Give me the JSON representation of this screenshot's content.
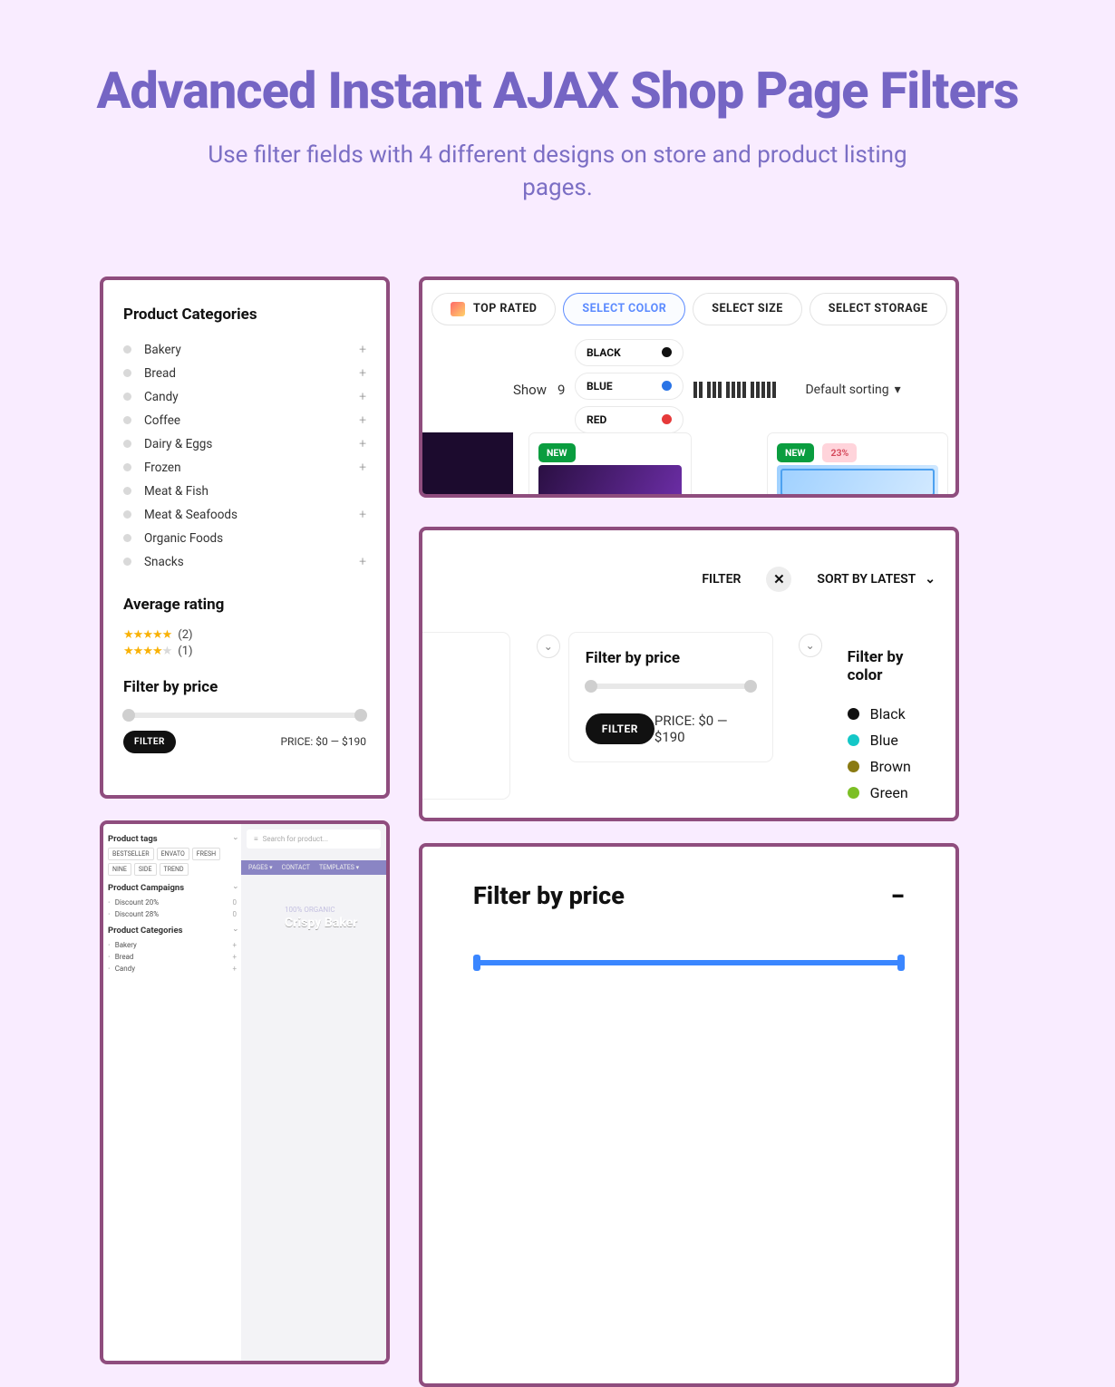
{
  "heading": "Advanced Instant AJAX Shop Page Filters",
  "subheading": "Use filter fields with 4 different designs on store and product listing pages.",
  "sidebar": {
    "title_categories": "Product Categories",
    "categories": [
      {
        "label": "Bakery",
        "expand": true
      },
      {
        "label": "Bread",
        "expand": true
      },
      {
        "label": "Candy",
        "expand": true
      },
      {
        "label": "Coffee",
        "expand": true
      },
      {
        "label": "Dairy & Eggs",
        "expand": true
      },
      {
        "label": "Frozen",
        "expand": true
      },
      {
        "label": "Meat & Fish",
        "expand": false
      },
      {
        "label": "Meat & Seafoods",
        "expand": true
      },
      {
        "label": "Organic Foods",
        "expand": false
      },
      {
        "label": "Snacks",
        "expand": true
      }
    ],
    "title_rating": "Average rating",
    "ratings": [
      {
        "stars": 5,
        "count": "(2)"
      },
      {
        "stars": 4,
        "count": "(1)"
      }
    ],
    "title_price": "Filter by price",
    "filter_btn": "FILTER",
    "price_text": "PRICE: $0 — $190"
  },
  "colorCard": {
    "pills": [
      "TOP RATED",
      "SELECT COLOR",
      "SELECT SIZE",
      "SELECT STORAGE"
    ],
    "colors": [
      {
        "name": "BLACK",
        "hex": "#111"
      },
      {
        "name": "BLUE",
        "hex": "#2a74e6"
      },
      {
        "name": "RED",
        "hex": "#e63a3a"
      }
    ],
    "show_label": "Show",
    "show_value": "9",
    "sort": "Default sorting",
    "badge_new": "NEW",
    "badge_disc": "23%"
  },
  "filterCard": {
    "filter_label": "FILTER",
    "sort_label": "SORT BY LATEST",
    "price_title": "Filter by price",
    "price_button": "FILTER",
    "price_text": "PRICE: $0 — $190",
    "color_title": "Filter by color",
    "colors": [
      {
        "name": "Black",
        "hex": "#111"
      },
      {
        "name": "Blue",
        "hex": "#14c7c7"
      },
      {
        "name": "Brown",
        "hex": "#8a7a12"
      },
      {
        "name": "Green",
        "hex": "#7cbf25"
      }
    ]
  },
  "compact": {
    "title_tags": "Product tags",
    "tags": [
      "BESTSELLER",
      "ENVATO",
      "FRESH",
      "NINE",
      "SIDE",
      "TREND"
    ],
    "title_campaigns": "Product Campaigns",
    "campaigns": [
      {
        "name": "Discount 20%",
        "n": "0"
      },
      {
        "name": "Discount 28%",
        "n": "0"
      }
    ],
    "title_categories": "Product Categories",
    "categories": [
      {
        "name": "Bakery",
        "n": "+"
      },
      {
        "name": "Bread",
        "n": "+"
      },
      {
        "name": "Candy",
        "n": "+"
      }
    ],
    "search_placeholder": "Search for product...",
    "nav": [
      "PAGES ▾",
      "CONTACT",
      "TEMPLATES ▾"
    ],
    "hero_eyebrow": "100% ORGANIC",
    "hero_title": "Crispy Baker"
  },
  "accordion": {
    "title": "Filter by price"
  }
}
